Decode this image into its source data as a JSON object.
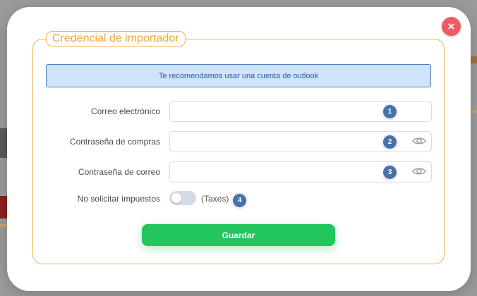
{
  "modal": {
    "title": "Credencial de importador",
    "close_icon": "×",
    "info": "Te recomendamos usar una cuenta de outlook",
    "fields": [
      {
        "label": "Correo electrónico",
        "value": "",
        "badge": "1"
      },
      {
        "label": "Contraseña de compras",
        "value": "",
        "badge": "2"
      },
      {
        "label": "Contraseña de correo",
        "value": "",
        "badge": "3"
      }
    ],
    "toggle": {
      "label": "No solicitar impuestos",
      "suffix": "(Taxes)",
      "badge": "4",
      "checked": false
    },
    "save_label": "Guardar"
  },
  "colors": {
    "accent_orange": "#f0b24a",
    "info_bg": "#cfe3fb",
    "badge_blue": "#4a70a8",
    "save_green": "#22c55e",
    "close_red": "#ef5b60"
  },
  "icons": [
    "close-icon",
    "eye-icon"
  ]
}
